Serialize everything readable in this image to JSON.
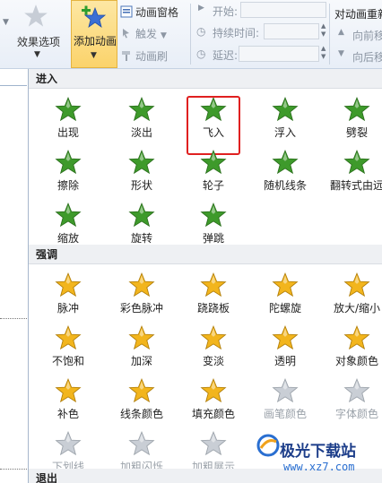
{
  "ribbon": {
    "effect_options": "效果选项",
    "add_animation": "添加动画",
    "animation_pane": "动画窗格",
    "trigger": "触发",
    "animation_painter": "动画刷",
    "start_label": "开始:",
    "duration_label": "持续时间:",
    "delay_label": "延迟:",
    "reorder_title": "对动画重新",
    "move_earlier": "向前移",
    "move_later": "向后移"
  },
  "gallery": {
    "sections": [
      {
        "title": "进入",
        "items": [
          {
            "label": "出现",
            "icon": "star-appear-icon"
          },
          {
            "label": "淡出",
            "icon": "star-fade-icon"
          },
          {
            "label": "飞入",
            "icon": "star-fly-in-icon",
            "highlighted": true
          },
          {
            "label": "浮入",
            "icon": "star-float-in-icon"
          },
          {
            "label": "劈裂",
            "icon": "star-split-icon"
          },
          {
            "label": "擦除",
            "icon": "star-wipe-icon"
          },
          {
            "label": "形状",
            "icon": "star-shape-icon"
          },
          {
            "label": "轮子",
            "icon": "star-wheel-icon"
          },
          {
            "label": "随机线条",
            "icon": "star-random-bars-icon"
          },
          {
            "label": "翻转式由远",
            "icon": "star-grow-turn-icon"
          },
          {
            "label": "缩放",
            "icon": "star-zoom-icon"
          },
          {
            "label": "旋转",
            "icon": "star-swivel-icon"
          },
          {
            "label": "弹跳",
            "icon": "star-bounce-icon"
          }
        ]
      },
      {
        "title": "强调",
        "items": [
          {
            "label": "脉冲",
            "icon": "star-pulse-icon"
          },
          {
            "label": "彩色脉冲",
            "icon": "star-color-pulse-icon"
          },
          {
            "label": "跷跷板",
            "icon": "star-teeter-icon"
          },
          {
            "label": "陀螺旋",
            "icon": "star-spin-icon"
          },
          {
            "label": "放大/缩小",
            "icon": "star-grow-shrink-icon"
          },
          {
            "label": "不饱和",
            "icon": "star-desaturate-icon"
          },
          {
            "label": "加深",
            "icon": "star-darken-icon"
          },
          {
            "label": "变淡",
            "icon": "star-lighten-icon"
          },
          {
            "label": "透明",
            "icon": "star-transparency-icon"
          },
          {
            "label": "对象颜色",
            "icon": "star-object-color-icon"
          },
          {
            "label": "补色",
            "icon": "star-complementary-color-icon"
          },
          {
            "label": "线条颜色",
            "icon": "star-line-color-icon"
          },
          {
            "label": "填充颜色",
            "icon": "star-fill-color-icon"
          },
          {
            "label": "画笔颜色",
            "icon": "star-brush-color-icon",
            "disabled": true
          },
          {
            "label": "字体颜色",
            "icon": "star-font-color-icon",
            "disabled": true
          },
          {
            "label": "下划线",
            "icon": "star-underline-icon",
            "disabled": true
          },
          {
            "label": "加粗闪烁",
            "icon": "star-bold-flash-icon",
            "disabled": true
          },
          {
            "label": "加粗展示",
            "icon": "star-bold-reveal-icon",
            "disabled": true
          }
        ]
      },
      {
        "title": "退出",
        "items": []
      }
    ]
  },
  "watermark": {
    "name": "极光下载站",
    "url": "www.xz7.com"
  },
  "colors": {
    "entrance_green": "#3e9a2b",
    "emphasis_gold": "#f2b51d",
    "highlight_red": "#e02020"
  }
}
